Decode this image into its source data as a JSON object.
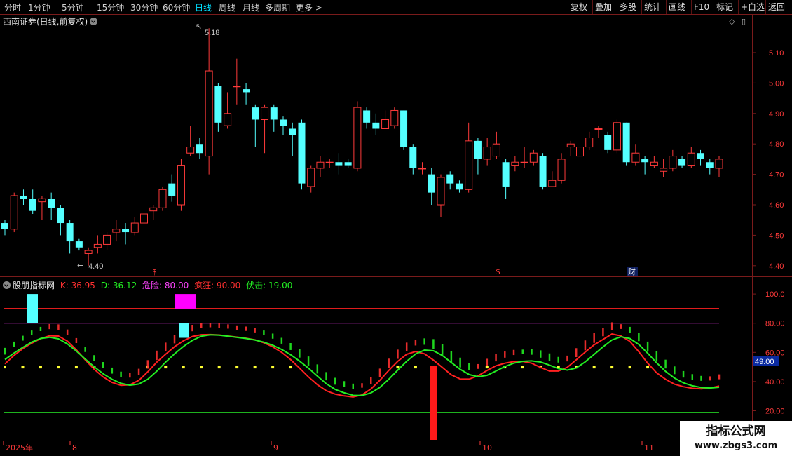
{
  "toolbar": {
    "periods": [
      "分时",
      "1分钟",
      "5分钟",
      "15分钟",
      "30分钟",
      "60分钟",
      "日线",
      "周线",
      "月线",
      "多周期",
      "更多"
    ],
    "active_period": "日线",
    "more_glyph": ">",
    "buttons": [
      "复权",
      "叠加",
      "多股",
      "统计",
      "画线",
      "F10",
      "标记",
      "+自选",
      "返回"
    ]
  },
  "main_chart": {
    "title": "西南证券(日线,前复权)",
    "high_label": "5.18",
    "low_label": "4.40",
    "price_ticks": [
      "5.10",
      "5.00",
      "4.90",
      "4.80",
      "4.70",
      "4.60",
      "4.50",
      "4.40"
    ],
    "event_markers": [
      "$",
      "$",
      "财"
    ],
    "icon_diamond": "◇",
    "icon_square": "▯"
  },
  "indicator": {
    "name": "股朋指标网",
    "k_label": "K: 36.95",
    "d_label": "D: 36.12",
    "danger_label": "危险: 80.00",
    "crazy_label": "疯狂: 90.00",
    "ambush_label": "伏击: 19.00",
    "ticks": [
      "100.0",
      "80.00",
      "60.00",
      "40.00",
      "20.00"
    ],
    "current_value": "49.00"
  },
  "x_axis": {
    "labels": [
      "2025年",
      "8",
      "9",
      "10",
      "11"
    ]
  },
  "watermark": {
    "line1": "指标公式网",
    "line2": "www.zbgs3.com"
  },
  "colors": {
    "up": "#ff3a3a",
    "down": "#54ffff",
    "k_line": "#ff2020",
    "d_line": "#22ee22",
    "grid": "#7a1b1b",
    "magenta": "#ff00ff",
    "yellow": "#ffff33"
  },
  "chart_data": {
    "type": "candlestick",
    "price_range": [
      4.4,
      5.18
    ],
    "candles": [
      [
        4.54,
        4.52,
        4.55,
        4.5
      ],
      [
        4.52,
        4.63,
        4.64,
        4.51
      ],
      [
        4.63,
        4.62,
        4.65,
        4.6
      ],
      [
        4.62,
        4.58,
        4.65,
        4.57
      ],
      [
        4.61,
        4.62,
        4.63,
        4.55
      ],
      [
        4.62,
        4.59,
        4.64,
        4.55
      ],
      [
        4.59,
        4.54,
        4.6,
        4.5
      ],
      [
        4.54,
        4.48,
        4.55,
        4.44
      ],
      [
        4.48,
        4.46,
        4.49,
        4.45
      ],
      [
        4.44,
        4.45,
        4.46,
        4.4
      ],
      [
        4.46,
        4.47,
        4.5,
        4.44
      ],
      [
        4.47,
        4.5,
        4.51,
        4.45
      ],
      [
        4.51,
        4.52,
        4.55,
        4.48
      ],
      [
        4.52,
        4.51,
        4.54,
        4.47
      ],
      [
        4.51,
        4.54,
        4.56,
        4.5
      ],
      [
        4.54,
        4.57,
        4.58,
        4.52
      ],
      [
        4.58,
        4.59,
        4.6,
        4.55
      ],
      [
        4.59,
        4.65,
        4.66,
        4.58
      ],
      [
        4.67,
        4.63,
        4.7,
        4.61
      ],
      [
        4.6,
        4.73,
        4.75,
        4.58
      ],
      [
        4.77,
        4.79,
        4.86,
        4.76
      ],
      [
        4.8,
        4.77,
        4.82,
        4.75
      ],
      [
        4.76,
        5.04,
        5.18,
        4.7
      ],
      [
        4.99,
        4.87,
        5.0,
        4.84
      ],
      [
        4.86,
        4.9,
        4.97,
        4.85
      ],
      [
        4.99,
        4.99,
        5.08,
        4.93
      ],
      [
        4.98,
        4.97,
        5.0,
        4.93
      ],
      [
        4.92,
        4.88,
        4.93,
        4.79
      ],
      [
        4.88,
        4.92,
        4.93,
        4.77
      ],
      [
        4.92,
        4.88,
        4.93,
        4.84
      ],
      [
        4.88,
        4.86,
        4.89,
        4.83
      ],
      [
        4.85,
        4.83,
        4.87,
        4.76
      ],
      [
        4.87,
        4.67,
        4.88,
        4.65
      ],
      [
        4.66,
        4.72,
        4.73,
        4.64
      ],
      [
        4.72,
        4.74,
        4.76,
        4.69
      ],
      [
        4.74,
        4.74,
        4.75,
        4.72
      ],
      [
        4.74,
        4.73,
        4.77,
        4.7
      ],
      [
        4.74,
        4.73,
        4.75,
        4.72
      ],
      [
        4.72,
        4.92,
        4.94,
        4.71
      ],
      [
        4.91,
        4.87,
        4.92,
        4.85
      ],
      [
        4.87,
        4.85,
        4.9,
        4.83
      ],
      [
        4.85,
        4.88,
        4.91,
        4.85
      ],
      [
        4.86,
        4.91,
        4.92,
        4.85
      ],
      [
        4.91,
        4.79,
        4.91,
        4.78
      ],
      [
        4.79,
        4.72,
        4.8,
        4.7
      ],
      [
        4.72,
        4.72,
        4.74,
        4.7
      ],
      [
        4.7,
        4.64,
        4.72,
        4.6
      ],
      [
        4.6,
        4.69,
        4.7,
        4.56
      ],
      [
        4.7,
        4.67,
        4.71,
        4.65
      ],
      [
        4.67,
        4.65,
        4.68,
        4.64
      ],
      [
        4.65,
        4.81,
        4.87,
        4.64
      ],
      [
        4.81,
        4.75,
        4.82,
        4.7
      ],
      [
        4.75,
        4.79,
        4.82,
        4.73
      ],
      [
        4.76,
        4.8,
        4.84,
        4.75
      ],
      [
        4.74,
        4.66,
        4.75,
        4.62
      ],
      [
        4.73,
        4.74,
        4.76,
        4.71
      ],
      [
        4.74,
        4.74,
        4.79,
        4.72
      ],
      [
        4.74,
        4.77,
        4.78,
        4.73
      ],
      [
        4.76,
        4.66,
        4.77,
        4.65
      ],
      [
        4.66,
        4.68,
        4.71,
        4.66
      ],
      [
        4.68,
        4.75,
        4.77,
        4.67
      ],
      [
        4.79,
        4.8,
        4.81,
        4.76
      ],
      [
        4.76,
        4.79,
        4.83,
        4.75
      ],
      [
        4.79,
        4.82,
        4.84,
        4.78
      ],
      [
        4.85,
        4.85,
        4.86,
        4.82
      ],
      [
        4.83,
        4.78,
        4.84,
        4.77
      ],
      [
        4.78,
        4.87,
        4.88,
        4.77
      ],
      [
        4.87,
        4.74,
        4.87,
        4.73
      ],
      [
        4.74,
        4.77,
        4.8,
        4.73
      ],
      [
        4.75,
        4.74,
        4.76,
        4.7
      ],
      [
        4.73,
        4.74,
        4.76,
        4.72
      ],
      [
        4.71,
        4.72,
        4.75,
        4.69
      ],
      [
        4.72,
        4.76,
        4.78,
        4.71
      ],
      [
        4.75,
        4.73,
        4.76,
        4.72
      ],
      [
        4.73,
        4.77,
        4.79,
        4.72
      ],
      [
        4.77,
        4.75,
        4.78,
        4.73
      ],
      [
        4.74,
        4.72,
        4.75,
        4.7
      ],
      [
        4.72,
        4.75,
        4.76,
        4.69
      ]
    ],
    "indicator_range": [
      10,
      105
    ],
    "k_values": [
      52.1,
      57.8,
      62.6,
      66.3,
      69.4,
      71.4,
      71.2,
      67.7,
      61.8,
      54.9,
      48.4,
      43.2,
      39.4,
      37.4,
      37.8,
      40.8,
      46.7,
      53.2,
      58.7,
      63.9,
      68.0,
      70.9,
      72.1,
      72.2,
      71.9,
      71.2,
      70.5,
      69.7,
      68.6,
      66.6,
      63.8,
      60.0,
      55.1,
      49.3,
      43.2,
      37.9,
      33.7,
      31.4,
      30.2,
      29.4,
      30.9,
      34.9,
      40.9,
      47.7,
      53.9,
      58.7,
      60.6,
      59.0,
      54.7,
      49.7,
      44.6,
      41.8,
      41.7,
      44.0,
      47.6,
      50.8,
      52.6,
      53.7,
      53.8,
      52.6,
      49.7,
      47.2,
      47.2,
      49.8,
      54.9,
      60.2,
      65.2,
      68.9,
      72.6,
      71.3,
      67.6,
      60.5,
      52.6,
      46.0,
      41.6,
      38.2,
      36.5,
      35.4,
      35.0,
      35.6,
      36.95
    ],
    "d_values": [
      55.1,
      59.4,
      63.4,
      67.0,
      69.5,
      70.4,
      69.3,
      65.8,
      60.9,
      55.5,
      50.1,
      45.4,
      41.6,
      38.8,
      37.5,
      38.3,
      41.6,
      47.0,
      53.3,
      59.0,
      64.1,
      68.2,
      71.1,
      72.0,
      71.8,
      71.1,
      70.3,
      69.5,
      68.5,
      67.0,
      64.9,
      62.0,
      58.4,
      54.1,
      49.2,
      43.8,
      38.5,
      34.6,
      32.3,
      30.6,
      30.5,
      32.2,
      36.0,
      41.6,
      47.9,
      53.9,
      58.9,
      61.6,
      61.1,
      57.9,
      53.1,
      48.4,
      44.8,
      43.3,
      44.3,
      47.2,
      50.3,
      52.6,
      53.9,
      54.2,
      53.4,
      51.3,
      48.9,
      47.9,
      49.3,
      53.5,
      58.6,
      63.8,
      68.5,
      70.7,
      69.5,
      65.5,
      59.4,
      52.9,
      47.0,
      42.4,
      39.2,
      37.1,
      35.9,
      35.6,
      36.12
    ],
    "danger_level": 80.0,
    "crazy_level": 90.0,
    "ambush_level": 19.0
  }
}
